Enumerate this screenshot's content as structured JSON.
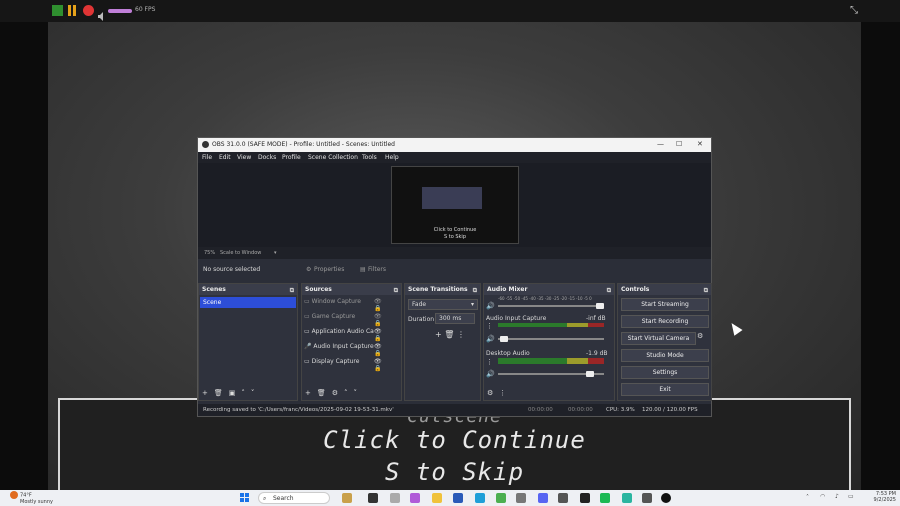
{
  "topbar": {
    "fps": "60 FPS",
    "fullscreen_icon": "fullscreen-exit-icon"
  },
  "cutscene": {
    "title": "Cutscene",
    "continue": "Click to Continue",
    "skip": "S to Skip"
  },
  "obs": {
    "title": "OBS 31.0.0 (SAFE MODE) - Profile: Untitled - Scenes: Untitled",
    "menu": [
      "File",
      "Edit",
      "View",
      "Docks",
      "Profile",
      "Scene Collection",
      "Tools",
      "Help"
    ],
    "preview": {
      "continue": "Click to Continue",
      "skip": "S to Skip"
    },
    "zoom": {
      "value": "75%",
      "mode": "Scale to Window"
    },
    "propbar": {
      "no_source": "No source selected",
      "properties": "Properties",
      "filters": "Filters"
    },
    "scenes": {
      "title": "Scenes",
      "items": [
        "Scene"
      ]
    },
    "sources": {
      "title": "Sources",
      "items": [
        "Window Capture",
        "Game Capture",
        "Application Audio Ca",
        "Audio Input Capture",
        "Display Capture"
      ]
    },
    "transitions": {
      "title": "Scene Transitions",
      "type": "Fade",
      "duration_label": "Duration",
      "duration": "300 ms"
    },
    "mixer": {
      "title": "Audio Mixer",
      "scale": "-60 -55 -50 -45 -40 -35 -30 -25 -20 -15 -10 -5 0",
      "channels": [
        {
          "name": "Audio Input Capture",
          "db": "-inf dB"
        },
        {
          "name": "Desktop Audio",
          "db": "-1.9 dB"
        }
      ]
    },
    "controls": {
      "title": "Controls",
      "buttons": [
        "Start Streaming",
        "Start Recording",
        "Start Virtual Camera",
        "Studio Mode",
        "Settings",
        "Exit"
      ]
    },
    "status": {
      "message": "Recording saved to 'C:/Users/franc/Videos/2025-09-02 19-53-31.mkv'",
      "stream_time": "00:00:00",
      "rec_time": "00:00:00",
      "cpu": "CPU: 3.9%",
      "fps": "120.00 / 120.00 FPS"
    }
  },
  "taskbar": {
    "weather_temp": "74°F",
    "weather_desc": "Mostly sunny",
    "search": "Search",
    "time": "7:53 PM",
    "date": "9/2/2025"
  }
}
